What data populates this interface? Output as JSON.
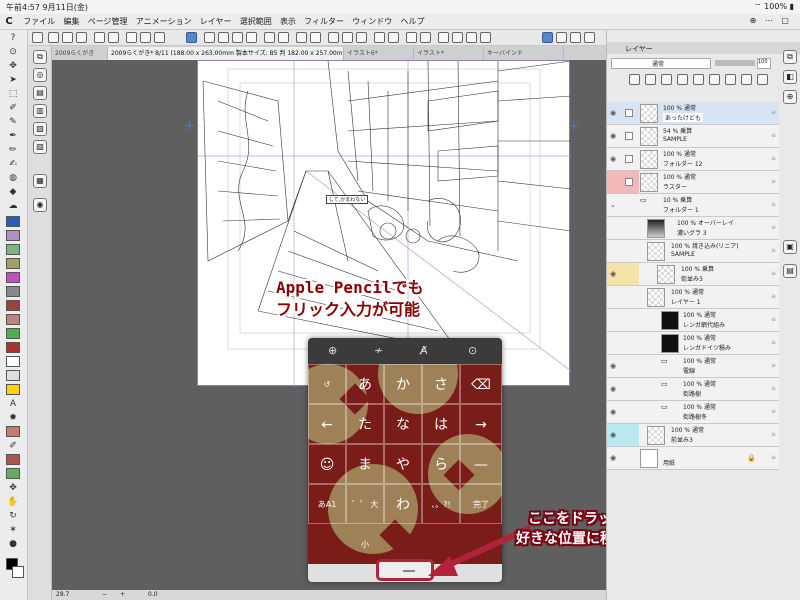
{
  "status": {
    "time": "午前4:57",
    "date": "9月11日(金)",
    "battery": "100%"
  },
  "menu": {
    "logo": "C",
    "items": [
      "ファイル",
      "編集",
      "ページ管理",
      "アニメーション",
      "レイヤー",
      "選択範囲",
      "表示",
      "フィルター",
      "ウィンドウ",
      "ヘルプ"
    ]
  },
  "tabs": [
    {
      "label": "2009らくがき"
    },
    {
      "label": "2009らくがき* 8/11 (188.00 x 263.00mm 製本サイズ: B5 判 182.00 x 257.00mm 600dpi 28.7%)"
    },
    {
      "label": "イラスト6*"
    },
    {
      "label": "イラスト*"
    },
    {
      "label": "キーバインド"
    }
  ],
  "panel": {
    "title": "レイヤー",
    "blend_mode": "通常",
    "opacity": "100",
    "layers": [
      {
        "blend": "100 % 通常",
        "name": "あったけども",
        "selected": true,
        "marker": ""
      },
      {
        "blend": "54 % 乗算",
        "name": "SAMPLE",
        "selected": false,
        "marker": ""
      },
      {
        "blend": "100 % 通常",
        "name": "フォルダー 12",
        "selected": false,
        "marker": ""
      },
      {
        "blend": "100 % 通常",
        "name": "ラスター",
        "selected": false,
        "marker": "pink"
      },
      {
        "blend": "10 % 乗算",
        "name": "フォルダー 1",
        "selected": false,
        "marker": ""
      },
      {
        "blend": "100 % オーバーレイ",
        "name": "濃いグラ 3",
        "selected": false,
        "marker": ""
      },
      {
        "blend": "100 % 焼き込み(リニア)",
        "name": "SAMPLE",
        "selected": false,
        "marker": ""
      },
      {
        "blend": "100 % 乗算",
        "name": "街並み3",
        "selected": false,
        "marker": "yellow"
      },
      {
        "blend": "100 % 通常",
        "name": "レイヤー 1",
        "selected": false,
        "marker": ""
      },
      {
        "blend": "100 % 通常",
        "name": "レンガ網代組み",
        "selected": false,
        "marker": ""
      },
      {
        "blend": "100 % 通常",
        "name": "レンガドイツ積み",
        "selected": false,
        "marker": ""
      },
      {
        "blend": "100 % 通常",
        "name": "電線",
        "selected": false,
        "marker": ""
      },
      {
        "blend": "100 % 通常",
        "name": "街路樹",
        "selected": false,
        "marker": ""
      },
      {
        "blend": "100 % 通常",
        "name": "街路樹冬",
        "selected": false,
        "marker": ""
      },
      {
        "blend": "100 % 通常",
        "name": "前並み3",
        "selected": false,
        "marker": "cyan"
      },
      {
        "blend": "",
        "name": "用紙",
        "selected": false,
        "marker": ""
      }
    ]
  },
  "canvas": {
    "caption_box": "して,かまわない"
  },
  "keyboard": {
    "top_icons": [
      "globe-icon",
      "cursor-icon",
      "no-handwriting-icon",
      "hide-keyboard-icon"
    ],
    "rows": [
      [
        "↺",
        "あ",
        "か",
        "さ",
        "⌫"
      ],
      [
        "←",
        "た",
        "な",
        "は",
        "→"
      ],
      [
        "☺",
        "ま",
        "や",
        "ら",
        "—"
      ],
      [
        "あA1",
        "゛゜ 大 小",
        "わ",
        "、。?!",
        "完了"
      ]
    ]
  },
  "callouts": {
    "top_line1": "Apple Pencilでも",
    "top_line2": "フリック入力が可能",
    "bottom_line1": "ここをドラッグで",
    "bottom_line2": "好きな位置に移動できます"
  },
  "bottombar": {
    "zoom": "28.7",
    "minus": "−",
    "plus": "+",
    "angle": "0.0"
  },
  "colors": {
    "callout_red": "#8b0000",
    "arrow_red": "#b0233a",
    "keyboard_bg": "#7a1c18",
    "accent_blue": "#5a86c8"
  }
}
